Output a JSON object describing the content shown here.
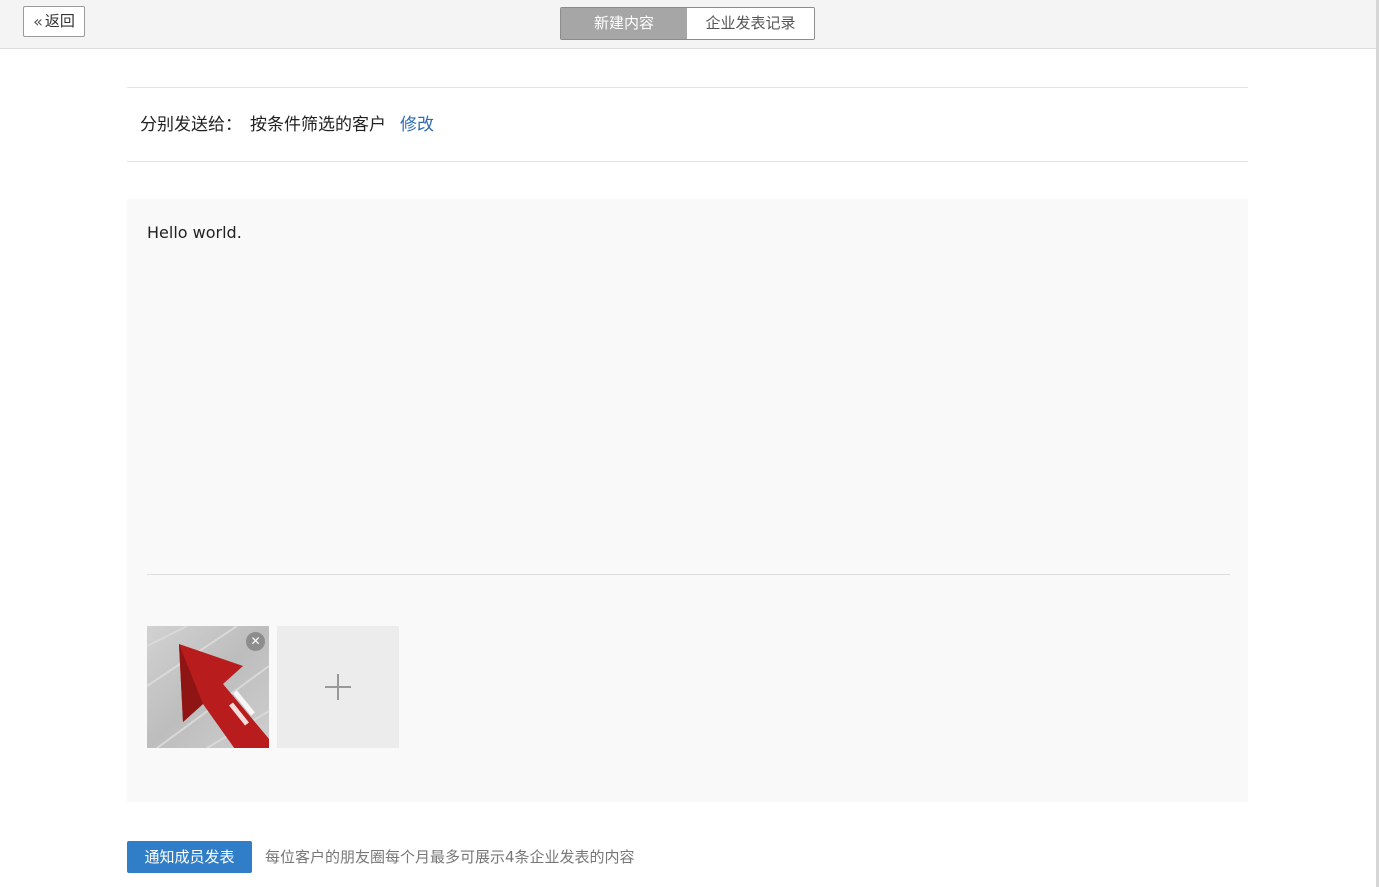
{
  "header": {
    "back_label": "返回",
    "back_icon": "double-chevron-left-icon",
    "tabs": [
      {
        "label": "新建内容",
        "active": true
      },
      {
        "label": "企业发表记录",
        "active": false
      }
    ]
  },
  "recipients": {
    "label": "分别发送给：",
    "target": "按条件筛选的客户",
    "edit_label": "修改"
  },
  "editor": {
    "text": "Hello world.",
    "images": [
      {
        "icon": "red-arrow-image",
        "remove_icon": "close-icon"
      }
    ],
    "add_icon": "plus-icon"
  },
  "footer": {
    "notify_label": "通知成员发表",
    "hint": "每位客户的朋友圈每个月最多可展示4条企业发表的内容"
  },
  "colors": {
    "accent": "#2f7ec7",
    "link": "#2f6bb4",
    "tab_active_bg": "#a6a6a6",
    "image_red": "#b81c1c"
  }
}
